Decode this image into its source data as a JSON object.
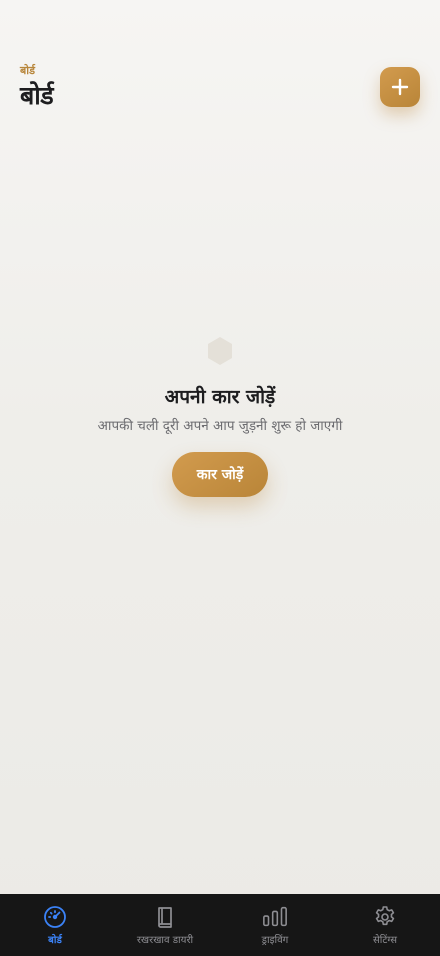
{
  "header": {
    "eyebrow": "बोर्ड",
    "title": "बोर्ड",
    "add_button_glyph": "+"
  },
  "empty_state": {
    "icon": "hexagon-icon",
    "title": "अपनी कार जोड़ें",
    "subtitle": "आपकी चली दूरी अपने आप जुड़नी शुरू हो जाएगी",
    "button_label": "कार जोड़ें"
  },
  "tab_bar": {
    "active_index": 0,
    "tabs": [
      {
        "label": "बोर्ड",
        "icon": "speedometer-icon"
      },
      {
        "label": "रखरखाव डायरी",
        "icon": "book-icon"
      },
      {
        "label": "ड्राइविंग",
        "icon": "bar-chart-icon"
      },
      {
        "label": "सेटिंग्स",
        "icon": "gear-icon"
      }
    ]
  },
  "colors": {
    "accent": "#c4914a",
    "active_tab": "#3b82f6",
    "inactive_tab": "#8e8e93",
    "tab_bar_bg": "#161616"
  }
}
